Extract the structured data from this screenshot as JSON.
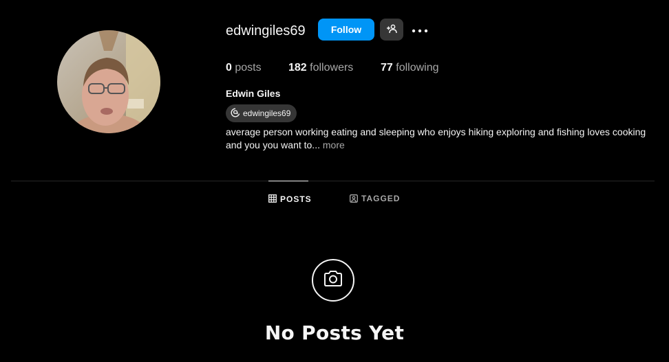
{
  "profile": {
    "username": "edwingiles69",
    "full_name": "Edwin Giles",
    "threads_handle": "edwingiles69",
    "bio": "average person working eating and sleeping who enjoys hiking exploring and fishing loves cooking and you you want to...",
    "bio_more": " more"
  },
  "actions": {
    "follow_label": "Follow",
    "suggest_icon": "add-person-icon",
    "more_icon": "more-options-icon"
  },
  "stats": {
    "posts_count": "0",
    "posts_label": "posts",
    "followers_count": "182",
    "followers_label": "followers",
    "following_count": "77",
    "following_label": "following"
  },
  "tabs": [
    {
      "label": "POSTS",
      "icon": "grid-icon",
      "active": true
    },
    {
      "label": "TAGGED",
      "icon": "tagged-icon",
      "active": false
    }
  ],
  "empty_state": {
    "icon": "camera-icon",
    "title": "No Posts Yet"
  },
  "colors": {
    "background": "#000000",
    "primary_button": "#0095f6",
    "secondary_button": "#363636",
    "muted_text": "#a8a8a8",
    "divider": "#262626"
  }
}
